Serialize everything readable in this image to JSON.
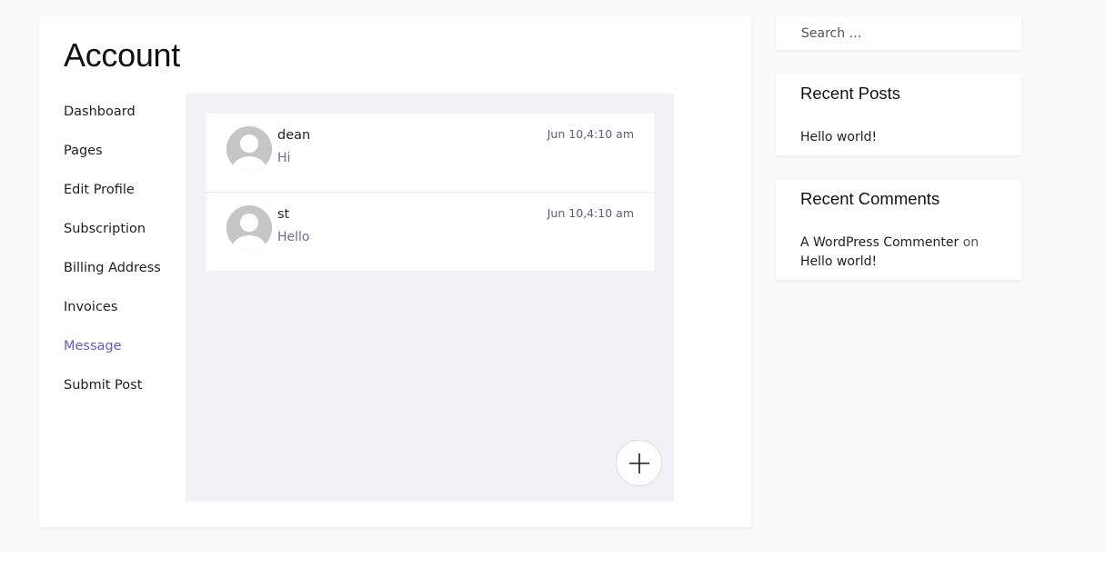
{
  "account": {
    "title": "Account",
    "nav": [
      {
        "label": "Dashboard",
        "active": false
      },
      {
        "label": "Pages",
        "active": false
      },
      {
        "label": "Edit Profile",
        "active": false
      },
      {
        "label": "Subscription",
        "active": false
      },
      {
        "label": "Billing Address",
        "active": false
      },
      {
        "label": "Invoices",
        "active": false
      },
      {
        "label": "Message",
        "active": true
      },
      {
        "label": "Submit Post",
        "active": false
      }
    ]
  },
  "messages": [
    {
      "name": "dean",
      "text": "Hi",
      "time": "Jun 10,4:10 am"
    },
    {
      "name": "st",
      "text": "Hello",
      "time": "Jun 10,4:10 am"
    }
  ],
  "icons": {
    "avatar": "default-avatar-icon",
    "add": "plus-icon"
  },
  "colors": {
    "accent": "#5b5bd6",
    "panel_bg": "#f1f2f6",
    "page_bg": "#f9f9f9"
  },
  "sidebar": {
    "search": {
      "placeholder": "Search …",
      "value": ""
    },
    "recent_posts": {
      "title": "Recent Posts",
      "items": [
        "Hello world!"
      ]
    },
    "recent_comments": {
      "title": "Recent Comments",
      "items": [
        {
          "author": "A WordPress Commenter",
          "connector": "on",
          "post": "Hello world!"
        }
      ]
    }
  }
}
